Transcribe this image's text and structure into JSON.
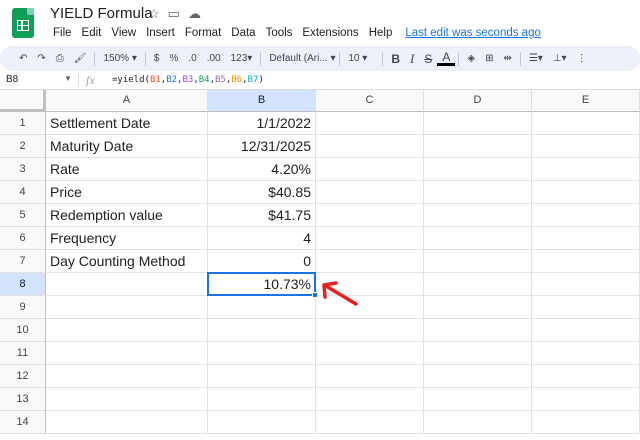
{
  "app": {
    "doc_title": "YIELD Formula",
    "menus": [
      "File",
      "Edit",
      "View",
      "Insert",
      "Format",
      "Data",
      "Tools",
      "Extensions",
      "Help"
    ],
    "last_edit": "Last edit was seconds ago"
  },
  "toolbar": {
    "zoom": "150%",
    "currency": "$",
    "percent": "%",
    "dec_decrease": ".0",
    "dec_increase": ".00",
    "more_formats": "123",
    "font": "Default (Ari...",
    "font_size": "10",
    "bold": "B",
    "italic": "I",
    "strike": "S",
    "text_color": "A"
  },
  "formula_bar": {
    "name_box": "B8",
    "fx": "fx",
    "formula_prefix": "=yield(",
    "refs": [
      {
        "text": "B1",
        "color": "#f4511e"
      },
      {
        "text": "B2",
        "color": "#1a73e8"
      },
      {
        "text": "B3",
        "color": "#a142f4"
      },
      {
        "text": "B4",
        "color": "#0f9d58"
      },
      {
        "text": "B5",
        "color": "#9e69af"
      },
      {
        "text": "B6",
        "color": "#f09300"
      },
      {
        "text": "B7",
        "color": "#00acc1"
      }
    ],
    "formula_suffix": ")"
  },
  "grid": {
    "columns": [
      "A",
      "B",
      "C",
      "D",
      "E"
    ],
    "rows": [
      "1",
      "2",
      "3",
      "4",
      "5",
      "6",
      "7",
      "8",
      "9",
      "10",
      "11",
      "12",
      "13",
      "14"
    ],
    "cells": [
      [
        "Settlement Date",
        "1/1/2022"
      ],
      [
        "Maturity Date",
        "12/31/2025"
      ],
      [
        "Rate",
        "4.20%"
      ],
      [
        "Price",
        "$40.85"
      ],
      [
        "Redemption value",
        "$41.75"
      ],
      [
        "Frequency",
        "4"
      ],
      [
        "Day Counting Method",
        "0"
      ],
      [
        "",
        "10.73%"
      ]
    ],
    "selected_cell": "B8"
  },
  "colors": {
    "accent": "#1a73e8",
    "annotation_arrow": "#e8201f",
    "header_selected": "#d3e3fd"
  }
}
